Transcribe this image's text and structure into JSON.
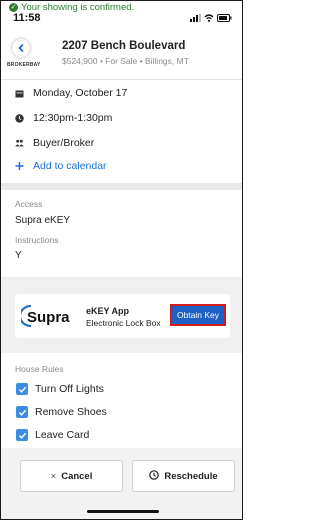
{
  "banner": {
    "text": "Your showing is confirmed."
  },
  "status_bar": {
    "time": "11:58"
  },
  "header": {
    "brand_text": "BROKERBAY",
    "title": "2207 Bench Boulevard",
    "subtitle": "$524,900 • For Sale • Billings, MT",
    "back_icon": "chevron-left-icon"
  },
  "showing": {
    "date": "Monday, October 17",
    "time": "12:30pm-1:30pm",
    "attendee": "Buyer/Broker",
    "add_calendar": "Add to calendar"
  },
  "access": {
    "access_label": "Access",
    "access_value": "Supra eKEY",
    "instructions_label": "Instructions",
    "instructions_value": "Y"
  },
  "ekey": {
    "logo_text": "Supra",
    "app_name": "eKEY App",
    "app_subtitle": "Electronic Lock Box",
    "button_label": "Obtain Key"
  },
  "house_rules": {
    "label": "House Rules",
    "items": [
      {
        "label": "Turn Off Lights",
        "checked": true
      },
      {
        "label": "Remove Shoes",
        "checked": true
      },
      {
        "label": "Leave Card",
        "checked": true
      }
    ]
  },
  "footer": {
    "cancel_label": "Cancel",
    "cancel_glyph": "×",
    "reschedule_label": "Reschedule"
  },
  "colors": {
    "accent_blue": "#1e6fd9",
    "checkbox_blue": "#3a8de0",
    "button_blue": "#1e5fc4",
    "highlight_red": "#d11b1b",
    "success_green": "#2e7d32"
  }
}
